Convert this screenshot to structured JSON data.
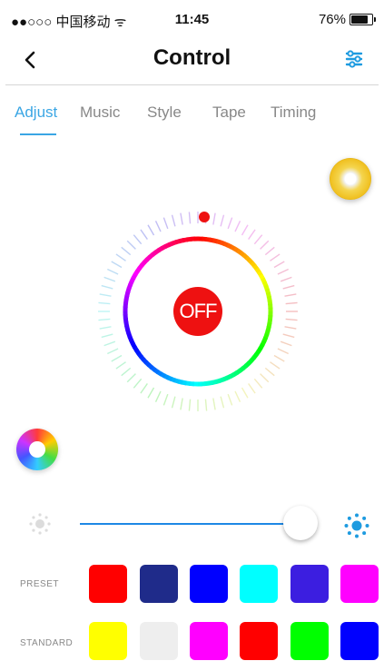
{
  "status_bar": {
    "carrier": "●●○○○ 中国移动 ᯤ",
    "time": "11:45",
    "battery": "76%",
    "battery_level": 0.76
  },
  "header": {
    "title": "Control"
  },
  "tabs": [
    {
      "label": "Adjust",
      "active": true
    },
    {
      "label": "Music",
      "active": false
    },
    {
      "label": "Style",
      "active": false
    },
    {
      "label": "Tape",
      "active": false
    },
    {
      "label": "Timing",
      "active": false
    }
  ],
  "power": {
    "label": "OFF",
    "color": "#ee1111"
  },
  "brightness": {
    "level": 0.92,
    "track_color": "#1e88e5"
  },
  "preset": {
    "label": "PRESET",
    "colors": [
      "#ff0000",
      "#1f2b8a",
      "#0000ff",
      "#00ffff",
      "#3c1ee0",
      "#ff00ff"
    ]
  },
  "standard": {
    "label": "STANDARD",
    "colors": [
      "#ffff00",
      "#eeeeee",
      "#ff00ff",
      "#ff0000",
      "#00ff00",
      "#0000ff"
    ]
  },
  "accent_color": "#3aa6e4"
}
